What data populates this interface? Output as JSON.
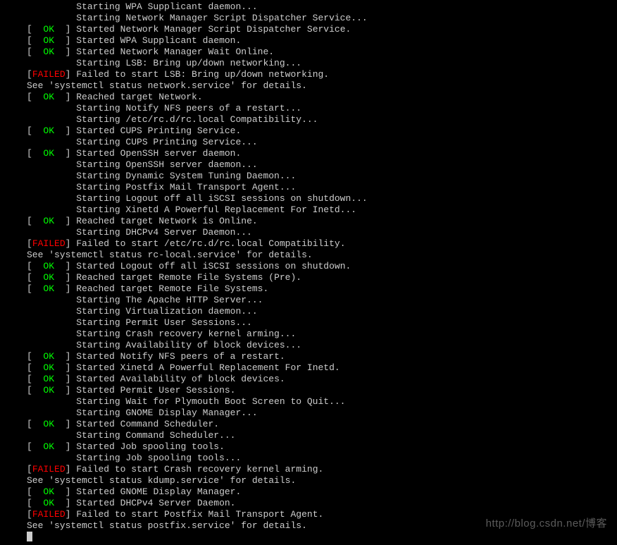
{
  "status": {
    "ok": "OK",
    "failed": "FAILED"
  },
  "lines": [
    {
      "type": "indent",
      "text": "Starting WPA Supplicant daemon..."
    },
    {
      "type": "indent",
      "text": "Starting Network Manager Script Dispatcher Service..."
    },
    {
      "type": "ok",
      "text": "Started Network Manager Script Dispatcher Service."
    },
    {
      "type": "ok",
      "text": "Started WPA Supplicant daemon."
    },
    {
      "type": "ok",
      "text": "Started Network Manager Wait Online."
    },
    {
      "type": "indent",
      "text": "Starting LSB: Bring up/down networking..."
    },
    {
      "type": "failed",
      "text": "Failed to start LSB: Bring up/down networking."
    },
    {
      "type": "plain",
      "text": "See 'systemctl status network.service' for details."
    },
    {
      "type": "ok",
      "text": "Reached target Network."
    },
    {
      "type": "indent",
      "text": "Starting Notify NFS peers of a restart..."
    },
    {
      "type": "indent",
      "text": "Starting /etc/rc.d/rc.local Compatibility..."
    },
    {
      "type": "ok",
      "text": "Started CUPS Printing Service."
    },
    {
      "type": "indent",
      "text": "Starting CUPS Printing Service..."
    },
    {
      "type": "ok",
      "text": "Started OpenSSH server daemon."
    },
    {
      "type": "indent",
      "text": "Starting OpenSSH server daemon..."
    },
    {
      "type": "indent",
      "text": "Starting Dynamic System Tuning Daemon..."
    },
    {
      "type": "indent",
      "text": "Starting Postfix Mail Transport Agent..."
    },
    {
      "type": "indent",
      "text": "Starting Logout off all iSCSI sessions on shutdown..."
    },
    {
      "type": "indent",
      "text": "Starting Xinetd A Powerful Replacement For Inetd..."
    },
    {
      "type": "ok",
      "text": "Reached target Network is Online."
    },
    {
      "type": "indent",
      "text": "Starting DHCPv4 Server Daemon..."
    },
    {
      "type": "failed",
      "text": "Failed to start /etc/rc.d/rc.local Compatibility."
    },
    {
      "type": "plain",
      "text": "See 'systemctl status rc-local.service' for details."
    },
    {
      "type": "ok",
      "text": "Started Logout off all iSCSI sessions on shutdown."
    },
    {
      "type": "ok",
      "text": "Reached target Remote File Systems (Pre)."
    },
    {
      "type": "ok",
      "text": "Reached target Remote File Systems."
    },
    {
      "type": "indent",
      "text": "Starting The Apache HTTP Server..."
    },
    {
      "type": "indent",
      "text": "Starting Virtualization daemon..."
    },
    {
      "type": "indent",
      "text": "Starting Permit User Sessions..."
    },
    {
      "type": "indent",
      "text": "Starting Crash recovery kernel arming..."
    },
    {
      "type": "indent",
      "text": "Starting Availability of block devices..."
    },
    {
      "type": "ok",
      "text": "Started Notify NFS peers of a restart."
    },
    {
      "type": "ok",
      "text": "Started Xinetd A Powerful Replacement For Inetd."
    },
    {
      "type": "ok",
      "text": "Started Availability of block devices."
    },
    {
      "type": "ok",
      "text": "Started Permit User Sessions."
    },
    {
      "type": "indent",
      "text": "Starting Wait for Plymouth Boot Screen to Quit..."
    },
    {
      "type": "indent",
      "text": "Starting GNOME Display Manager..."
    },
    {
      "type": "ok",
      "text": "Started Command Scheduler."
    },
    {
      "type": "indent",
      "text": "Starting Command Scheduler..."
    },
    {
      "type": "ok",
      "text": "Started Job spooling tools."
    },
    {
      "type": "indent",
      "text": "Starting Job spooling tools..."
    },
    {
      "type": "failed",
      "text": "Failed to start Crash recovery kernel arming."
    },
    {
      "type": "plain",
      "text": "See 'systemctl status kdump.service' for details."
    },
    {
      "type": "ok",
      "text": "Started GNOME Display Manager."
    },
    {
      "type": "ok",
      "text": "Started DHCPv4 Server Daemon."
    },
    {
      "type": "failed",
      "text": "Failed to start Postfix Mail Transport Agent."
    },
    {
      "type": "plain",
      "text": "See 'systemctl status postfix.service' for details."
    }
  ],
  "watermark": "http://blog.csdn.net/博客"
}
